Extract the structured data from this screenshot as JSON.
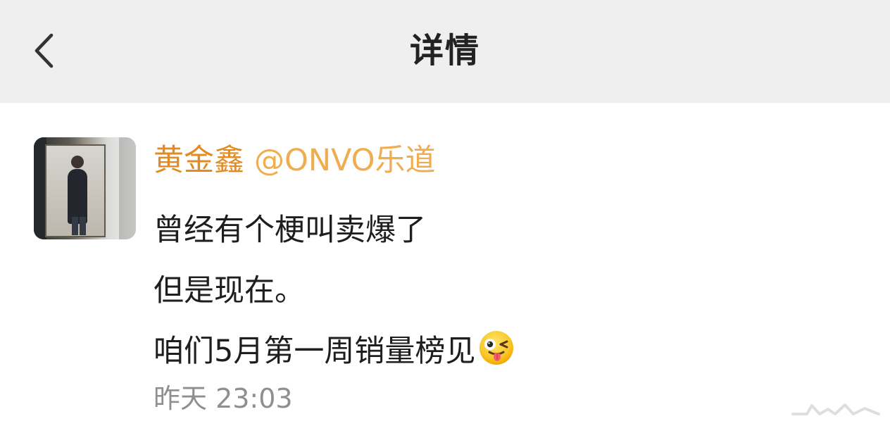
{
  "header": {
    "title": "详情",
    "back_icon": "chevron-left-icon"
  },
  "post": {
    "author": {
      "name": "黄金鑫",
      "avatar": "person-photo-avatar"
    },
    "mention": "@ONVO乐道",
    "lines": [
      "曾经有个梗叫卖爆了",
      "但是现在。",
      "咱们5月第一周销量榜见"
    ],
    "emoji": "winking-tongue-face-icon",
    "timestamp": "昨天 23:03"
  },
  "colors": {
    "header_bg": "#efefef",
    "name": "#e18b22",
    "mention": "#f0ad4f",
    "text": "#1e1e1e",
    "timestamp": "#8f8f8f"
  }
}
